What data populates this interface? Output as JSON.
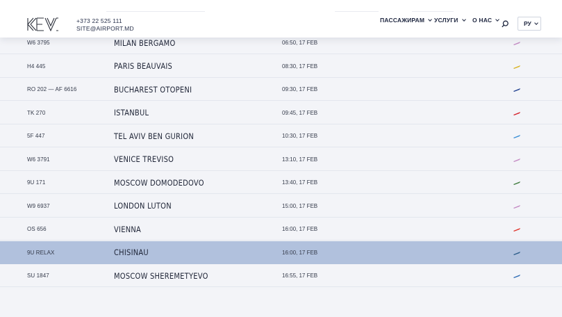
{
  "header": {
    "phone": "+373 22 525 111",
    "email": "SITE@AIRPORT.MD",
    "nav": [
      {
        "label": "ПАССАЖИРАМ"
      },
      {
        "label": "УСЛУГИ"
      },
      {
        "label": "О НАС"
      }
    ],
    "lang": "РУ",
    "icons": {
      "logo": "airport-logo-icon",
      "search": "search-icon",
      "chevron": "chevron-down-icon"
    }
  },
  "flights": [
    {
      "flight": "W6 3795",
      "destination": "MILAN BERGAMO",
      "time": "06:50, 17 FEB",
      "airline_color": "#c48ac4",
      "highlight": false
    },
    {
      "flight": "H4 445",
      "destination": "PARIS BEAUVAIS",
      "time": "08:30, 17 FEB",
      "airline_color": "#d8b21e",
      "highlight": false
    },
    {
      "flight": "RO 202 — AF 6616",
      "destination": "BUCHAREST OTOPENI",
      "time": "09:30, 17 FEB",
      "airline_color": "#1f3f8f",
      "highlight": false
    },
    {
      "flight": "TK 270",
      "destination": "ISTANBUL",
      "time": "09:45, 17 FEB",
      "airline_color": "#d4202a",
      "highlight": false
    },
    {
      "flight": "5F 447",
      "destination": "TEL AVIV BEN GURION",
      "time": "10:30, 17 FEB",
      "airline_color": "#3a8fd6",
      "highlight": false
    },
    {
      "flight": "W6 3791",
      "destination": "VENICE TREVISO",
      "time": "13:10, 17 FEB",
      "airline_color": "#c48ac4",
      "highlight": false
    },
    {
      "flight": "9U 171",
      "destination": "MOSCOW DOMODEDOVO",
      "time": "13:40, 17 FEB",
      "airline_color": "#3e7a3c",
      "highlight": false
    },
    {
      "flight": "W9 6937",
      "destination": "LONDON LUTON",
      "time": "15:00, 17 FEB",
      "airline_color": "#c48ac4",
      "highlight": false
    },
    {
      "flight": "OS 656",
      "destination": "VIENNA",
      "time": "16:00, 17 FEB",
      "airline_color": "#e0342b",
      "highlight": false
    },
    {
      "flight": "9U RELAX",
      "destination": "CHISINAU",
      "time": "16:00, 17 FEB",
      "airline_color": "#2c5d8a",
      "highlight": true
    },
    {
      "flight": "SU 1847",
      "destination": "MOSCOW SHEREMETYEVO",
      "time": "16:55, 17 FEB",
      "airline_color": "#2d6cb5",
      "highlight": false
    }
  ]
}
